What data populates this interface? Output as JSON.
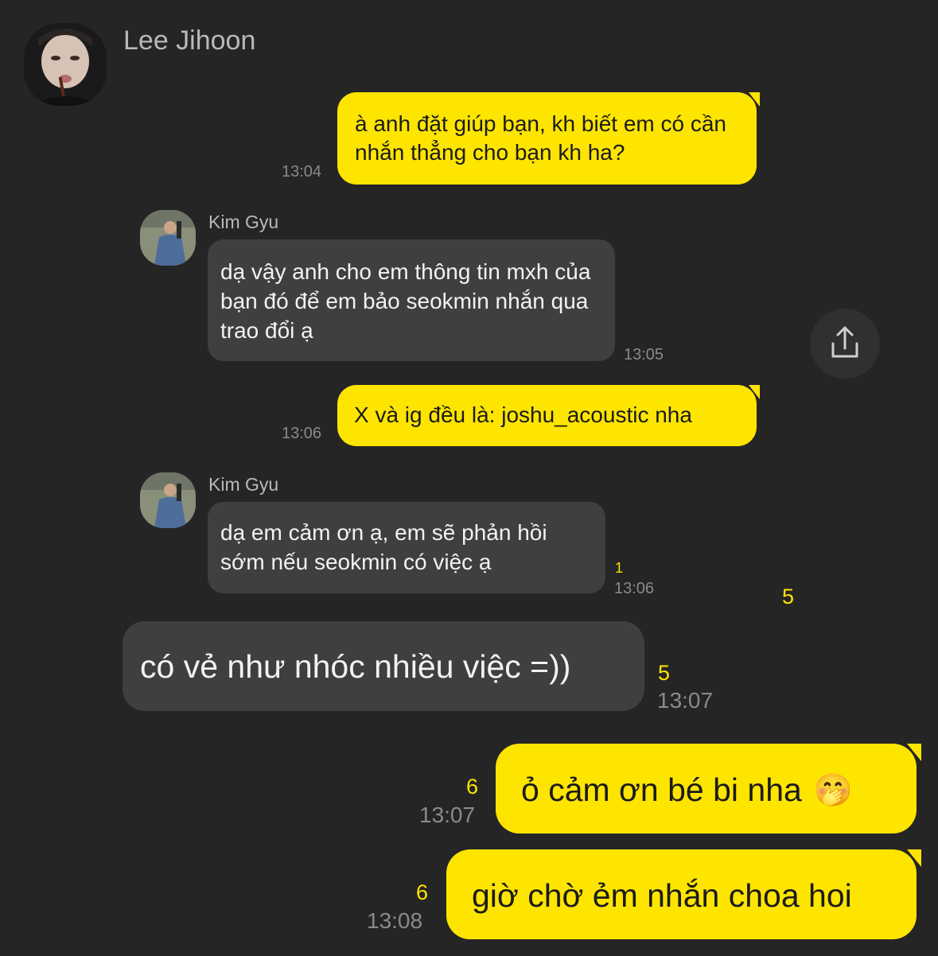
{
  "header": {
    "sender_name": "Lee Jihoon"
  },
  "messages": [
    {
      "from": "Lee Jihoon",
      "text": "à anh đặt giúp bạn, kh biết em có cần nhắn thẳng cho bạn kh ha?",
      "time": "13:04"
    },
    {
      "from": "Kim Gyu",
      "sender_name": "Kim Gyu",
      "text": "dạ vậy anh cho em thông tin mxh của bạn đó để em bảo seokmin nhắn qua trao đổi ạ",
      "time": "13:05"
    },
    {
      "from": "Lee Jihoon",
      "text": "X và ig đều là: joshu_acoustic nha",
      "time": "13:06"
    },
    {
      "from": "Kim Gyu",
      "sender_name": "Kim Gyu",
      "text": "dạ em cảm ơn ạ, em sẽ phản hồi sớm nếu seokmin có việc ạ",
      "time": "13:06",
      "unread": "1"
    },
    {
      "from": "Kim Gyu",
      "text": "có vẻ như nhóc nhiều việc =))",
      "time": "13:07",
      "unread": "5"
    },
    {
      "from": "Lee Jihoon",
      "text": "ỏ cảm ơn bé bi nha",
      "emoji": "🤭",
      "time": "13:07",
      "unread": "6"
    },
    {
      "from": "Lee Jihoon",
      "text": "giờ chờ ẻm nhắn choa hoi",
      "time": "13:08",
      "unread": "6"
    }
  ],
  "floating_unread": "5",
  "icons": {
    "share": "share-icon"
  },
  "colors": {
    "background": "#252526",
    "incoming_bubble": "#3f3f41",
    "outgoing_bubble": "#fee500",
    "unread": "#fee500"
  }
}
